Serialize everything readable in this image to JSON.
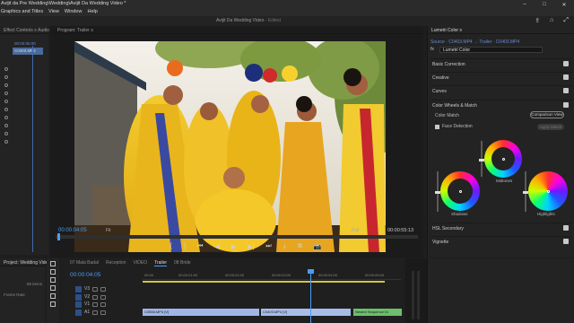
{
  "window": {
    "title": "Avijit da Pre Wedding\\Wedding\\Avijit Da Wedding Video *",
    "app_title": "Avijit Da Wedding Video",
    "app_title_state": " - Edited",
    "buttons": [
      "–",
      "□",
      "✕"
    ]
  },
  "menu": [
    "Graphics and Titles",
    "View",
    "Window",
    "Help"
  ],
  "source_panel": {
    "tab": "Effect Controls  ≡  Audio Clip Mixer: Trailer",
    "clip_label_dim": "00:00:05:00",
    "clip_label": "C0403.MP4"
  },
  "program": {
    "tab": "Program: Trailer  ≡",
    "timecode": "00:00:04:05",
    "fit": "Fit",
    "resolution": "Full",
    "duration": "00:00:55:13",
    "transport": [
      "{",
      "}",
      "⏮",
      "◀",
      "▶",
      "▶|",
      "⏭",
      "⤓",
      "⧉",
      "📷"
    ]
  },
  "lumetri": {
    "tab": "Lumetri Color  ≡",
    "source": "Source · C0403.MP4  →  Trailer · C0403.MP4",
    "fx_label": "fx",
    "fx_value": "Lumetri Color",
    "sections": [
      "Basic Correction",
      "Creative",
      "Curves",
      "Color Wheels & Match"
    ],
    "color_match_label": "Color Match",
    "comparison_view": "Comparison View",
    "face_detection": "Face Detection",
    "apply_match": "Apply Match",
    "wheels": {
      "midtones": "Midtones",
      "shadows": "Shadows",
      "highlights": "Highlights"
    },
    "lower_sections": [
      "HSL Secondary",
      "Vignette"
    ]
  },
  "project": {
    "tab": "Project: Wedding Video  ≡",
    "items_count": "86 items",
    "frame_rate_label": "Frame Rate",
    "rows": [
      "",
      "",
      ""
    ]
  },
  "timeline": {
    "tabs": [
      "07 Mala Badal",
      "Reception",
      "VIDEO",
      "Trailer",
      "08 Bride"
    ],
    "active_tab": "Trailer",
    "timecode": "00:00:04:05",
    "ruler": [
      "00:00",
      "00:00:01:00",
      "00:00:02:00",
      "00:00:03:00",
      "00:00:04:00",
      "00:00:05:00"
    ],
    "tracks": [
      "V3",
      "V2",
      "V1",
      "A1"
    ],
    "clips": [
      {
        "label": "C0556.MP4 [V]",
        "color": "#9fb6e8"
      },
      {
        "label": "C0403.MP4 [V]",
        "color": "#a7bce9"
      },
      {
        "label": "Nested Sequence 01",
        "color": "#6cc06c"
      }
    ]
  },
  "colors": {
    "accent": "#4a9cf5",
    "clip_blue": "#9fb6e8",
    "clip_green": "#6cc06c",
    "yellow_bar": "#d4c440"
  }
}
